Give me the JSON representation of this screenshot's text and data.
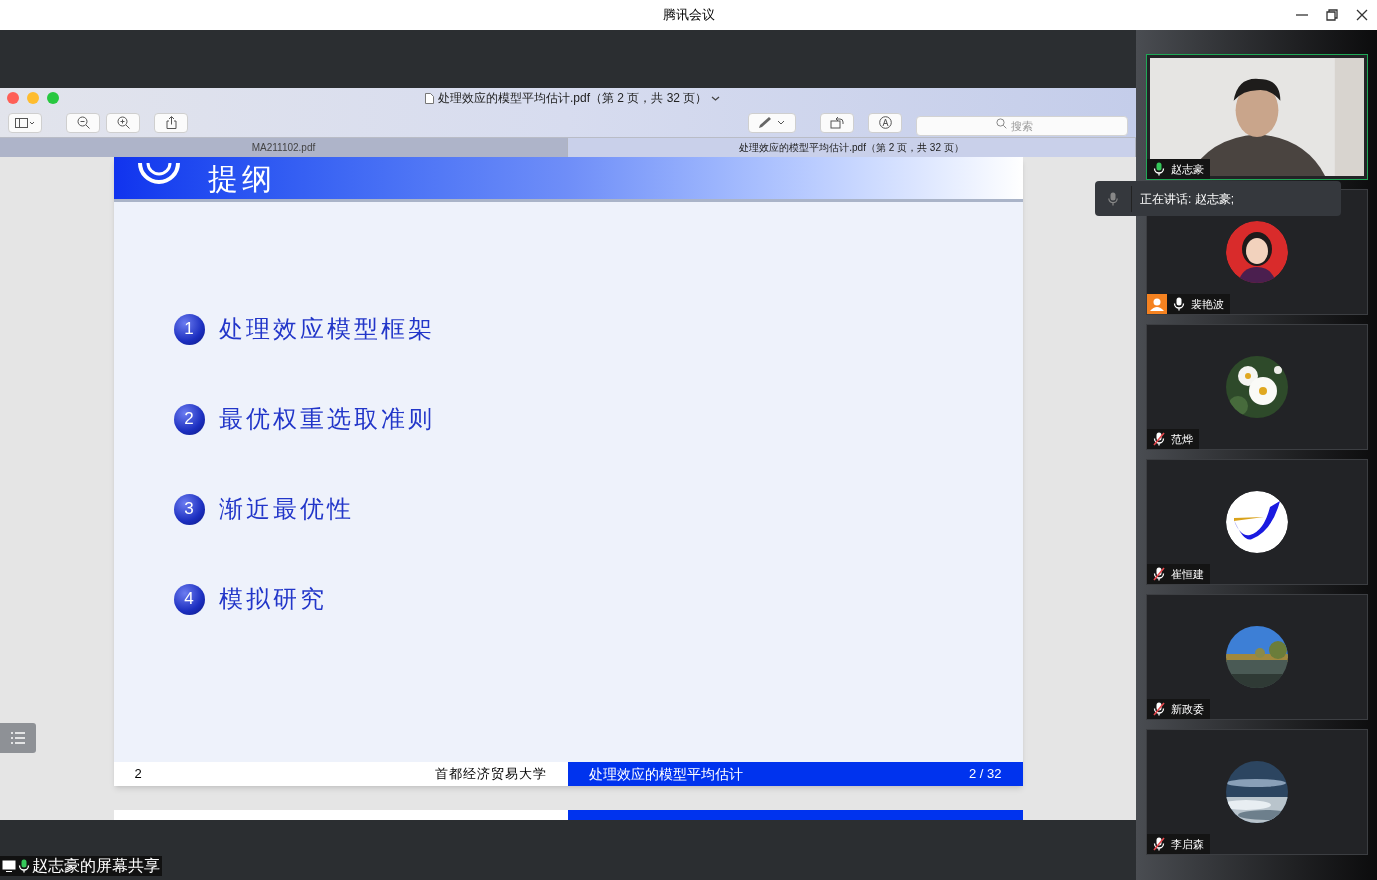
{
  "app": {
    "title": "腾讯会议"
  },
  "viewer": {
    "title": "处理效应的模型平均估计.pdf（第 2 页，共 32 页）",
    "search": {
      "placeholder": "搜索"
    },
    "tabs": [
      {
        "label": "MA211102.pdf",
        "selected": false
      },
      {
        "label": "处理效应的模型平均估计.pdf（第 2 页，共 32 页）",
        "selected": true
      }
    ]
  },
  "slide": {
    "heading": "提纲",
    "items": [
      {
        "number": "1",
        "text": "处理效应模型框架"
      },
      {
        "number": "2",
        "text": "最优权重选取准则"
      },
      {
        "number": "3",
        "text": "渐近最优性"
      },
      {
        "number": "4",
        "text": "模拟研究"
      }
    ],
    "footer": {
      "page": "2",
      "school": "首都经济贸易大学",
      "title": "处理效应的模型平均估计",
      "pages": "2 / 32"
    }
  },
  "participants": [
    {
      "name": "赵志豪",
      "kind": "video",
      "muted": false,
      "speaking": true,
      "host": false
    },
    {
      "name": "裴艳波",
      "kind": "cartoon",
      "muted": false,
      "speaking": false,
      "host": true
    },
    {
      "name": "范烨",
      "kind": "flower",
      "muted": true,
      "speaking": false,
      "host": false
    },
    {
      "name": "崔恒建",
      "kind": "logo",
      "muted": true,
      "speaking": false,
      "host": false
    },
    {
      "name": "新政委",
      "kind": "lake",
      "muted": true,
      "speaking": false,
      "host": false
    },
    {
      "name": "李启森",
      "kind": "sky",
      "muted": true,
      "speaking": false,
      "host": false
    }
  ],
  "speaking_banner": "正在讲话: 赵志豪;",
  "share_label": "赵志豪的屏幕共享"
}
